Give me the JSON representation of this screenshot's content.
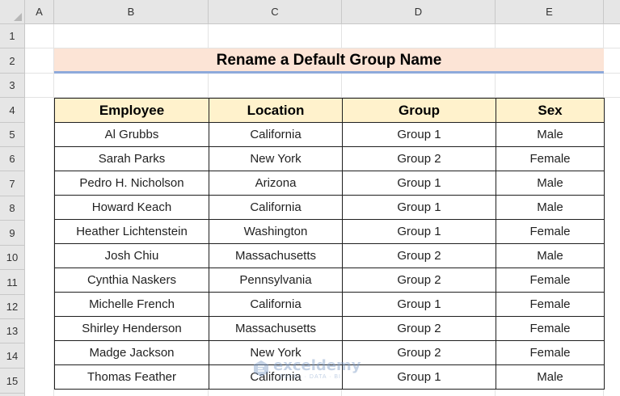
{
  "spreadsheet": {
    "column_headers": [
      "A",
      "B",
      "C",
      "D",
      "E"
    ],
    "row_headers": [
      "1",
      "2",
      "3",
      "4",
      "5",
      "6",
      "7",
      "8",
      "9",
      "10",
      "11",
      "12",
      "13",
      "14",
      "15"
    ]
  },
  "sheet": {
    "title": "Rename a Default Group Name",
    "table": {
      "headers": [
        "Employee",
        "Location",
        "Group",
        "Sex"
      ],
      "rows": [
        [
          "Al Grubbs",
          "California",
          "Group 1",
          "Male"
        ],
        [
          "Sarah Parks",
          "New York",
          "Group 2",
          "Female"
        ],
        [
          "Pedro H. Nicholson",
          "Arizona",
          "Group 1",
          "Male"
        ],
        [
          "Howard Keach",
          "California",
          "Group 1",
          "Male"
        ],
        [
          "Heather Lichtenstein",
          "Washington",
          "Group 1",
          "Female"
        ],
        [
          "Josh Chiu",
          "Massachusetts",
          "Group 2",
          "Male"
        ],
        [
          "Cynthia Naskers",
          "Pennsylvania",
          "Group 2",
          "Female"
        ],
        [
          "Michelle French",
          "California",
          "Group 1",
          "Female"
        ],
        [
          "Shirley Henderson",
          "Massachusetts",
          "Group 2",
          "Female"
        ],
        [
          "Madge Jackson",
          "New York",
          "Group 2",
          "Female"
        ],
        [
          "Thomas Feather",
          "California",
          "Group 1",
          "Male"
        ]
      ]
    }
  },
  "watermark": {
    "name": "exceldemy",
    "tagline": "EXCEL · DATA · BI"
  },
  "colors": {
    "title_fill": "#fce4d6",
    "title_underline": "#8eaadb",
    "header_fill": "#fff2cc",
    "grid_header_fill": "#e6e6e6"
  }
}
